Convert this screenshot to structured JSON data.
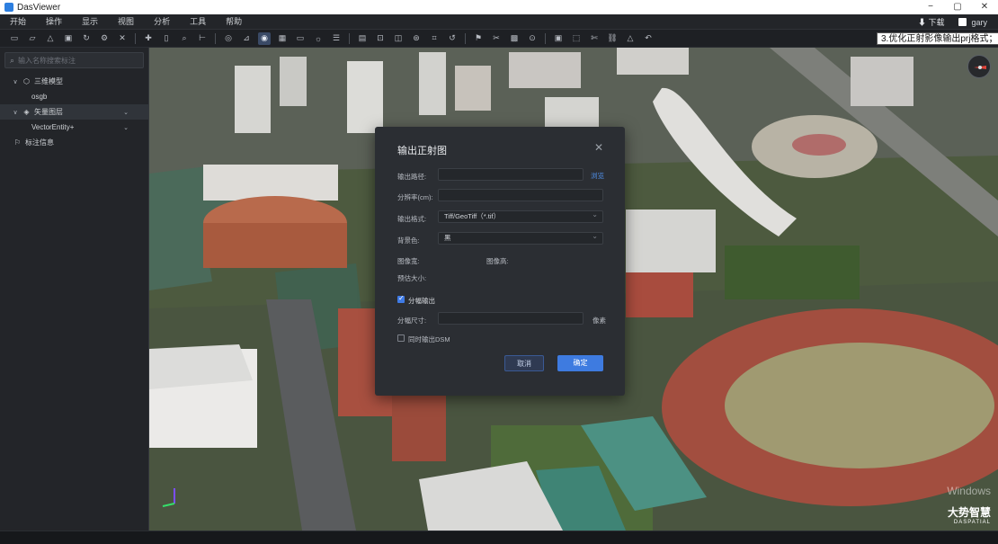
{
  "window": {
    "title": "DasViewer",
    "controls": [
      "−",
      "▢",
      "✕"
    ]
  },
  "menu": {
    "items": [
      "开始",
      "操作",
      "显示",
      "视图",
      "分析",
      "工具",
      "帮助"
    ],
    "download": "⬇ 下载",
    "user": "gary"
  },
  "toolbar": {
    "icons": [
      "new-doc",
      "open-folder",
      "upload",
      "save",
      "refresh",
      "settings",
      "close",
      "move",
      "select",
      "zoom",
      "measure",
      "layer",
      "tri",
      "target",
      "grid",
      "monitor",
      "sun",
      "list",
      "align",
      "focus",
      "frame",
      "camera",
      "crop",
      "rotate",
      "flag",
      "scissors",
      "image",
      "pin",
      "box",
      "cube",
      "cut",
      "link",
      "mountain",
      "rotate-left"
    ],
    "tooltip": "3.优化正射影像输出prj格式；"
  },
  "sidebar": {
    "search_placeholder": "输入名称搜索标注",
    "tree": [
      {
        "label": "三维模型",
        "level": 0,
        "expanded": true
      },
      {
        "label": "osgb",
        "level": 1
      },
      {
        "label": "矢量图层",
        "level": 0,
        "expanded": true,
        "selected": true
      },
      {
        "label": "VectorEntity+",
        "level": 1
      },
      {
        "label": "标注信息",
        "level": 0
      }
    ]
  },
  "dialog": {
    "title": "输出正射图",
    "fields": {
      "path_label": "输出路径:",
      "path_value": "",
      "browse": "浏览",
      "resolution_label": "分辨率(cm):",
      "resolution_value": "",
      "format_label": "输出格式:",
      "format_value": "Tiff/GeoTiff（*.tif）",
      "bg_label": "背景色:",
      "bg_value": "黑",
      "width_label": "图像宽:",
      "height_label": "图像高:",
      "size_label": "预估大小:",
      "split_label": "分幅输出",
      "split_checked": true,
      "tile_label": "分幅尺寸:",
      "tile_value": "",
      "tile_unit": "像素",
      "dsm_label": "同时输出DSM",
      "dsm_checked": false
    },
    "cancel": "取消",
    "ok": "确定"
  },
  "watermark": {
    "line1": "Windows",
    "brand": "大势智慧",
    "brand_en": "DASPATIAL"
  }
}
